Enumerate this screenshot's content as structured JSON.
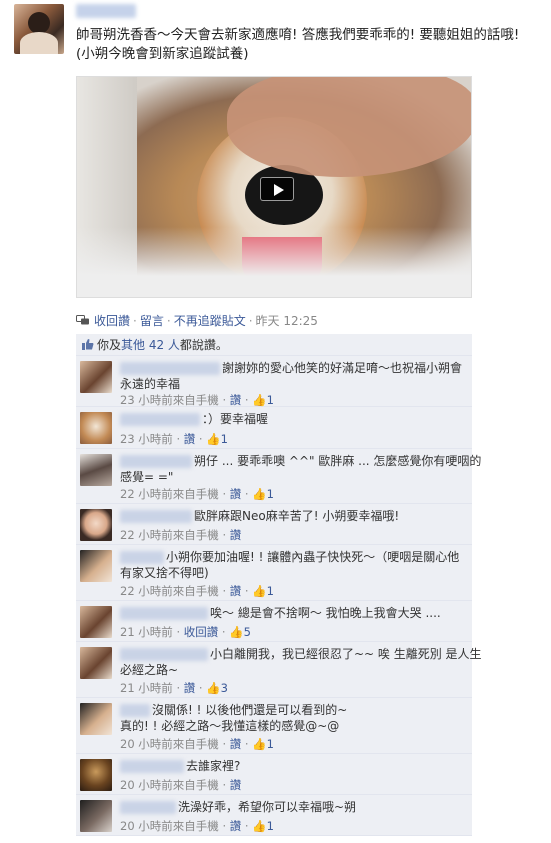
{
  "post": {
    "message": "帥哥朔洗香香～今天會去新家適應唷! 答應我們要乖乖的! 要聽姐姐的話哦! (小朔今晚會到新家追蹤試養)",
    "actions": {
      "retract_like": "收回讚",
      "comment": "留言",
      "unfollow": "不再追蹤貼文",
      "time": "昨天 12:25"
    },
    "likes": {
      "prefix": "你及",
      "others": "其他 42 人",
      "suffix": "都說讚。"
    }
  },
  "comments": [
    {
      "text_line1": "謝謝妳的愛心他笑的好滿足唷～也祝福小朔會",
      "text_line2": "永遠的幸福",
      "time": "23 小時前來自手機",
      "action": "讚",
      "likes": "1"
    },
    {
      "text_line1": "：）要幸福喔",
      "text_line2": "",
      "time": "23 小時前",
      "action": "讚",
      "likes": "1"
    },
    {
      "text_line1": "朔仔 ... 要乖乖噢 ^^\" 歐胖麻 ... 怎麼感覺你有哽咽的",
      "text_line2": "感覺= =\"",
      "time": "22 小時前來自手機",
      "action": "讚",
      "likes": "1"
    },
    {
      "text_line1": "歐胖麻跟Neo麻辛苦了! 小朔要幸福哦!",
      "text_line2": "",
      "time": "22 小時前來自手機",
      "action": "讚",
      "likes": ""
    },
    {
      "text_line1": "小朔你要加油喔! ! 讓體內蟲子快快死～（哽咽是關心他",
      "text_line2": "有家又捨不得吧)",
      "time": "22 小時前來自手機",
      "action": "讚",
      "likes": "1"
    },
    {
      "text_line1": "唉～ 總是會不捨啊～ 我怕晚上我會大哭 ....",
      "text_line2": "",
      "time": "21 小時前",
      "action": "收回讚",
      "likes": "5"
    },
    {
      "text_line1": "小白離開我，我已經很忍了~~ 唉 生離死別 是人生",
      "text_line2": "必經之路~",
      "time": "21 小時前",
      "action": "讚",
      "likes": "3"
    },
    {
      "text_line1": "沒關係! ! 以後他們還是可以看到的~",
      "text_line2": "真的! ! 必經之路～我懂這樣的感覺@~@",
      "time": "20 小時前來自手機",
      "action": "讚",
      "likes": "1"
    },
    {
      "text_line1": "去誰家裡?",
      "text_line2": "",
      "time": "20 小時前來自手機",
      "action": "讚",
      "likes": ""
    },
    {
      "text_line1": "洗澡好乖，希望你可以幸福哦~朔",
      "text_line2": "",
      "time": "20 小時前來自手機",
      "action": "讚",
      "likes": "1"
    }
  ],
  "colors": {
    "link": "#3b5998",
    "feedback_bg": "#edeff4",
    "meta": "#888888"
  },
  "icons": {
    "play": "play-icon",
    "like": "thumbs-up-icon",
    "follow": "speech-bubbles-icon"
  }
}
